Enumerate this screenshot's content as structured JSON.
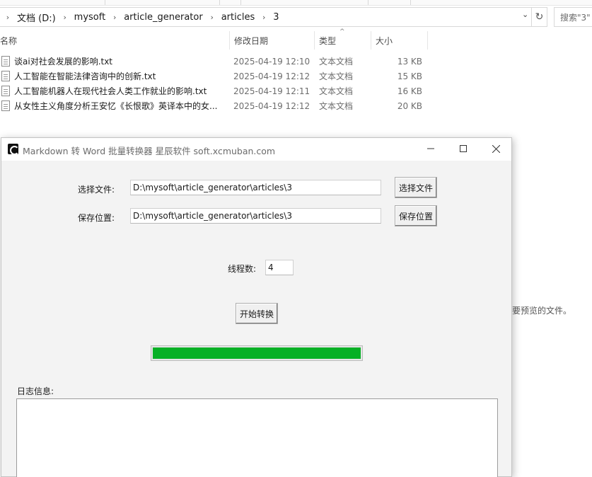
{
  "explorer": {
    "breadcrumbs": [
      "文档 (D:)",
      "mysoft",
      "article_generator",
      "articles",
      "3"
    ],
    "search_placeholder": "搜索\"3\"",
    "columns": {
      "name": "名称",
      "date": "修改日期",
      "type": "类型",
      "size": "大小"
    },
    "files": [
      {
        "name": "谈ai对社会发展的影响.txt",
        "date": "2025-04-19 12:10",
        "type": "文本文档",
        "size": "13 KB"
      },
      {
        "name": "人工智能在智能法律咨询中的创新.txt",
        "date": "2025-04-19 12:12",
        "type": "文本文档",
        "size": "15 KB"
      },
      {
        "name": "人工智能机器人在现代社会人类工作就业的影响.txt",
        "date": "2025-04-19 12:11",
        "type": "文本文档",
        "size": "16 KB"
      },
      {
        "name": "从女性主义角度分析王安忆《长恨歌》英译本中的女...",
        "date": "2025-04-19 12:12",
        "type": "文本文档",
        "size": "20 KB"
      }
    ],
    "preview_hint": "要预览的文件。"
  },
  "app": {
    "title": "Markdown 转 Word 批量转换器 星辰软件 soft.xcmuban.com",
    "select_file_label": "选择文件:",
    "select_file_value": "D:\\mysoft\\article_generator\\articles\\3",
    "select_file_button": "选择文件",
    "save_location_label": "保存位置:",
    "save_location_value": "D:\\mysoft\\article_generator\\articles\\3",
    "save_location_button": "保存位置",
    "threads_label": "线程数:",
    "threads_value": "4",
    "start_button": "开始转换",
    "progress_percent": 100,
    "log_label": "日志信息:"
  },
  "colors": {
    "progress_fill": "#06b025",
    "window_bg": "#f3f3f3"
  },
  "icons": {
    "app": "app-logo-icon",
    "file": "text-file-icon",
    "minimize": "minimize-icon",
    "maximize": "maximize-icon",
    "close": "close-icon",
    "refresh": "refresh-icon",
    "dropdown": "chevron-down-icon",
    "breadcrumb_separator": "chevron-right-icon"
  }
}
